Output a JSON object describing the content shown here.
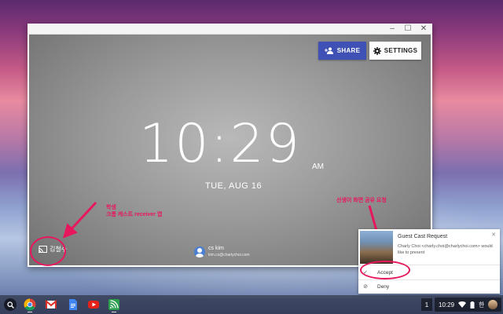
{
  "window": {
    "controls": [
      "–",
      "☐",
      "✕"
    ]
  },
  "stage": {
    "share_label": "SHARE",
    "settings_label": "SETTINGS",
    "time": "10:29",
    "ampm": "AM",
    "date": "TUE, AUG 16",
    "cast_name": "김철수",
    "user_name": "cs kim",
    "user_email": "kim.cs@charlychoi.com"
  },
  "annotations": {
    "left_line1": "학생",
    "left_line2": "크롬 캐스트 receiver 앱",
    "right": "선생이 화면 공유 요청"
  },
  "notification": {
    "title": "Guest Cast Request",
    "body": "Charly Choi <charly.choi@charlychoi.com> would like to present",
    "accept_label": "Accept",
    "deny_label": "Deny",
    "close": "✕",
    "accept_icon": "✓",
    "deny_icon": "⊘"
  },
  "shelf": {
    "apps": [
      "chrome-icon",
      "gmail-icon",
      "docs-icon",
      "youtube-icon",
      "cast-receiver-icon"
    ],
    "window_count": "1",
    "clock": "10:29",
    "ime": "한"
  },
  "colors": {
    "accent": "#3f51b5",
    "annotation": "#e8175d"
  }
}
